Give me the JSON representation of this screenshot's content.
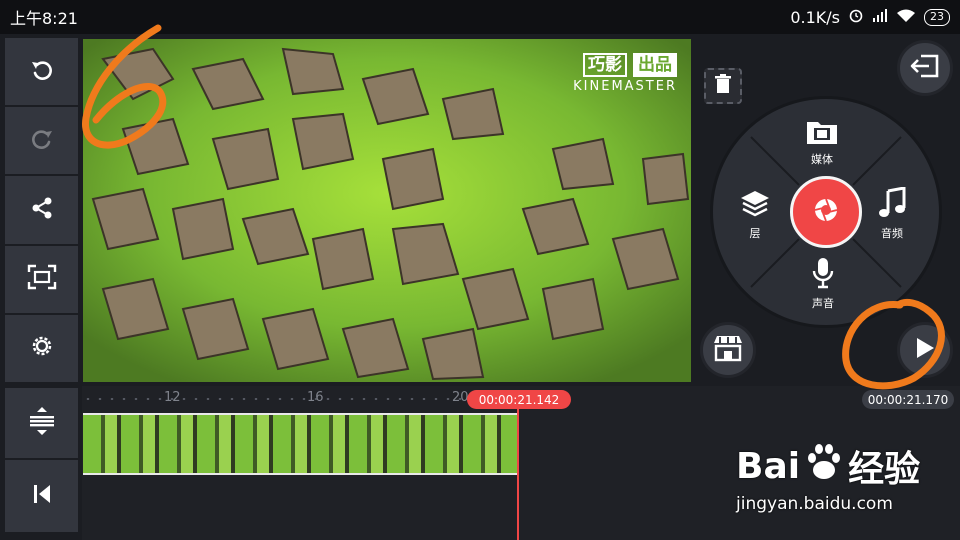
{
  "status_bar": {
    "time": "上午8:21",
    "network_speed": "0.1K/s",
    "battery": "23"
  },
  "left_toolbar": {
    "items": [
      {
        "name": "undo-icon",
        "enabled": true
      },
      {
        "name": "redo-icon",
        "enabled": false
      },
      {
        "name": "share-icon",
        "enabled": true
      },
      {
        "name": "aspect-ratio-icon",
        "enabled": true
      },
      {
        "name": "settings-gear-icon",
        "enabled": true
      }
    ]
  },
  "preview": {
    "watermark_top_left": "巧影",
    "watermark_top_right": "出品",
    "watermark_bottom": "KINEMASTER"
  },
  "wheel": {
    "media_label": "媒体",
    "layer_label": "层",
    "audio_label": "音频",
    "voice_label": "声音"
  },
  "timeline": {
    "ruler_labels": [
      "12",
      "16",
      "20"
    ],
    "playhead_time": "00:00:21.142",
    "total_time": "00:00:21.170"
  },
  "annotations": {
    "step_number": "6"
  },
  "baidu_watermark": {
    "logo_text_left": "Bai",
    "logo_text_right": "经验",
    "url": "jingyan.baidu.com"
  },
  "colors": {
    "accent": "#f04646",
    "annotation": "#f07a1c",
    "panel": "#33363e"
  }
}
